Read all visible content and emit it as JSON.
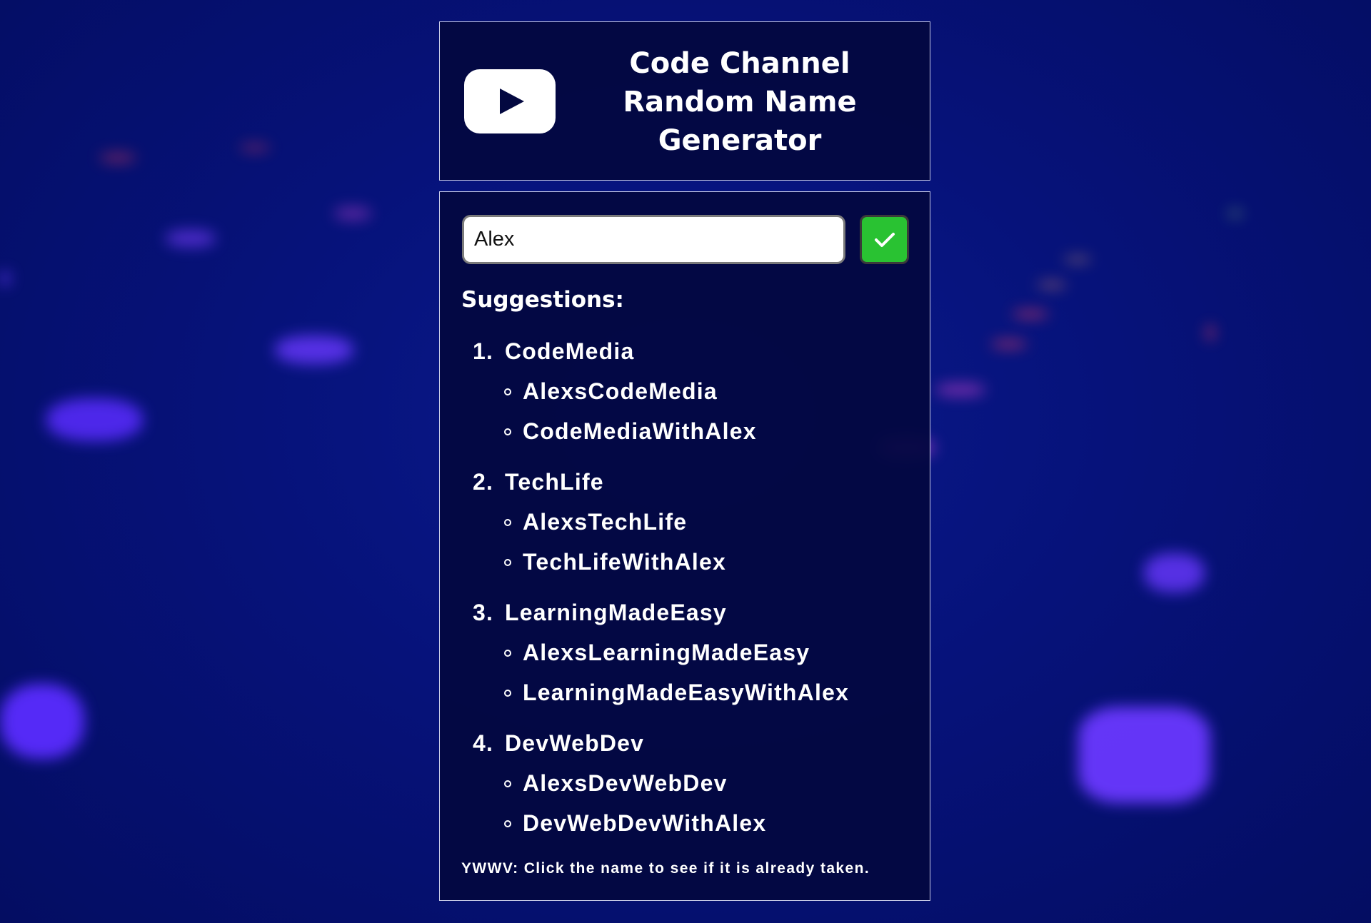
{
  "header": {
    "logo_icon": "youtube-play-icon",
    "title_line1": "Code Channel",
    "title_line2": "Random Name",
    "title_line3": "Generator"
  },
  "form": {
    "name_value": "Alex",
    "submit_icon": "checkmark-icon",
    "submit_color": "#29c232"
  },
  "suggestions": {
    "heading": "Suggestions:",
    "items": [
      {
        "number": "1.",
        "base": "CodeMedia",
        "variants": [
          "AlexsCodeMedia",
          "CodeMediaWithAlex"
        ]
      },
      {
        "number": "2.",
        "base": "TechLife",
        "variants": [
          "AlexsTechLife",
          "TechLifeWithAlex"
        ]
      },
      {
        "number": "3.",
        "base": "LearningMadeEasy",
        "variants": [
          "AlexsLearningMadeEasy",
          "LearningMadeEasyWithAlex"
        ]
      },
      {
        "number": "4.",
        "base": "DevWebDev",
        "variants": [
          "AlexsDevWebDev",
          "DevWebDevWithAlex"
        ]
      }
    ]
  },
  "footer": {
    "note": "YWWV: Click the name to see if it is already taken."
  },
  "colors": {
    "background": "#06127a",
    "panel": "#030840",
    "text": "#ffffff"
  }
}
